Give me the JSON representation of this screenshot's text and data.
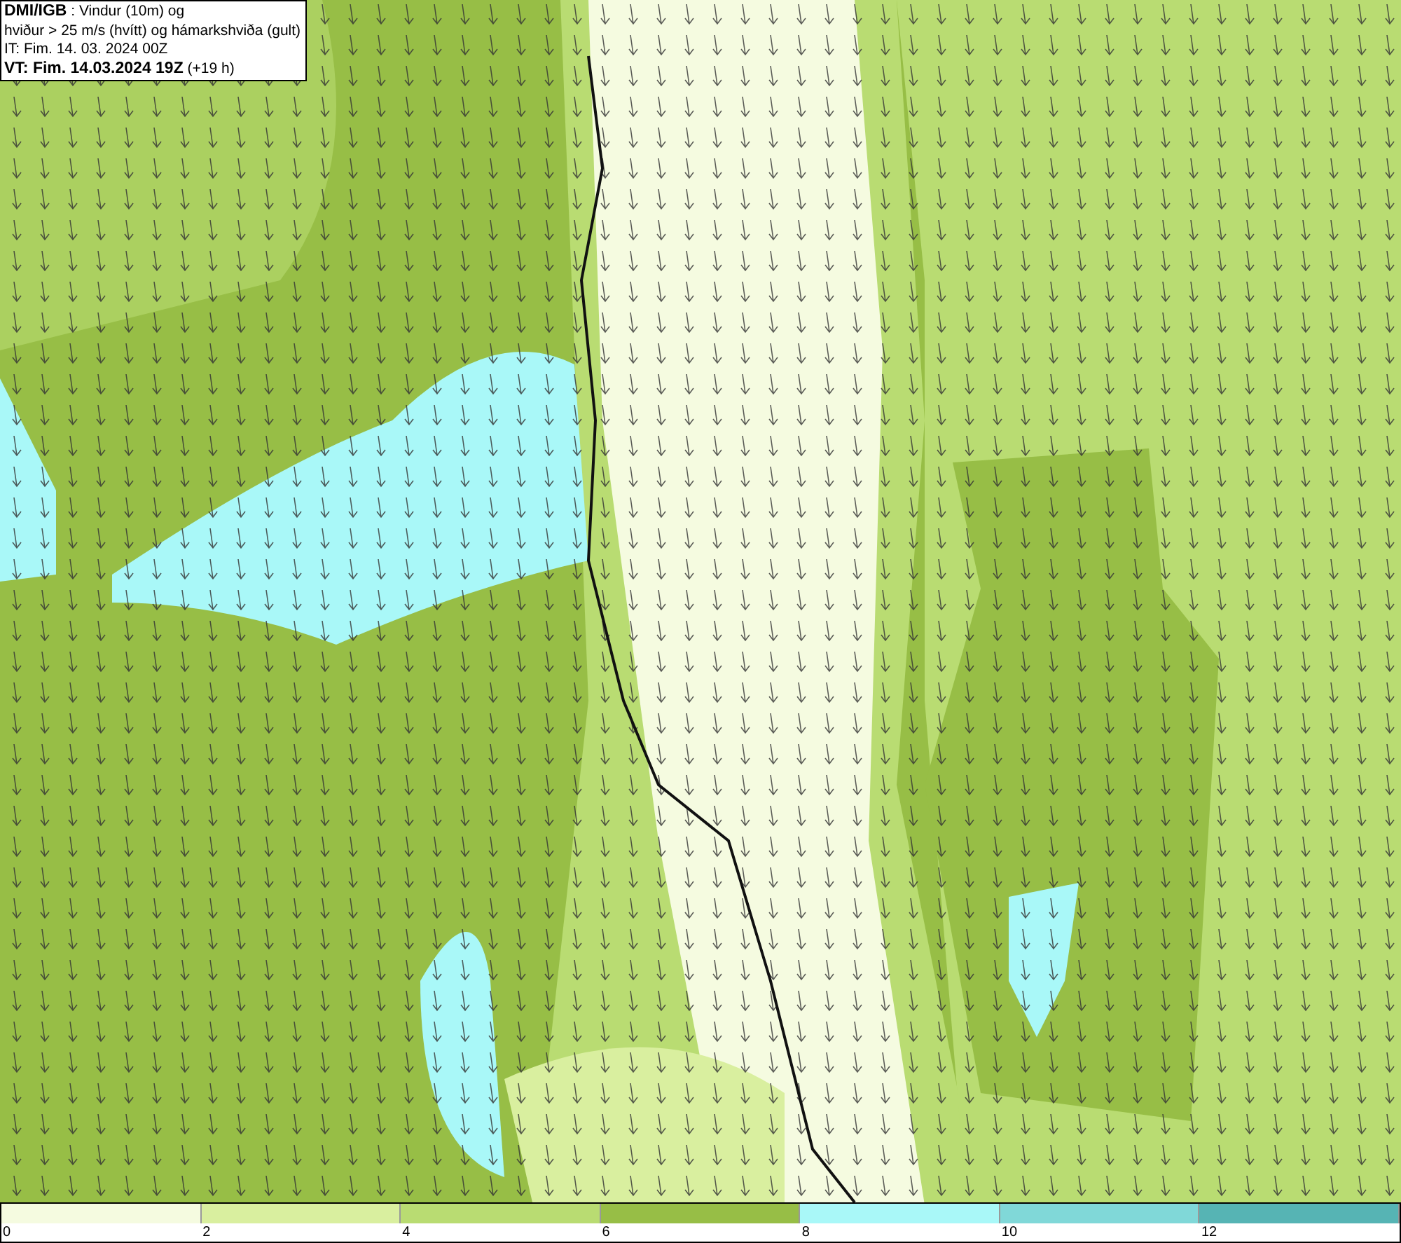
{
  "info_box": {
    "lines": [
      "**DMI/IGB** : Vindur (10m) og",
      "hviður > 25 m/s (hvítt) og hámarkshviða (gult)",
      "IT: Fim. 14. 03. 2024 00Z",
      "**VT: Fim. 14.03.2024 19Z** (+19 h)"
    ]
  },
  "legend": {
    "bins": [
      {
        "color": "#f5fbe0",
        "label": "0"
      },
      {
        "color": "#d9ef9f",
        "label": "2"
      },
      {
        "color": "#b9dc72",
        "label": "4"
      },
      {
        "color": "#97be46",
        "label": "6"
      },
      {
        "color": "#a9f8f8",
        "label": "8"
      },
      {
        "color": "#80d8d8",
        "label": "10"
      },
      {
        "color": "#56b4b4",
        "label": "12"
      }
    ]
  }
}
